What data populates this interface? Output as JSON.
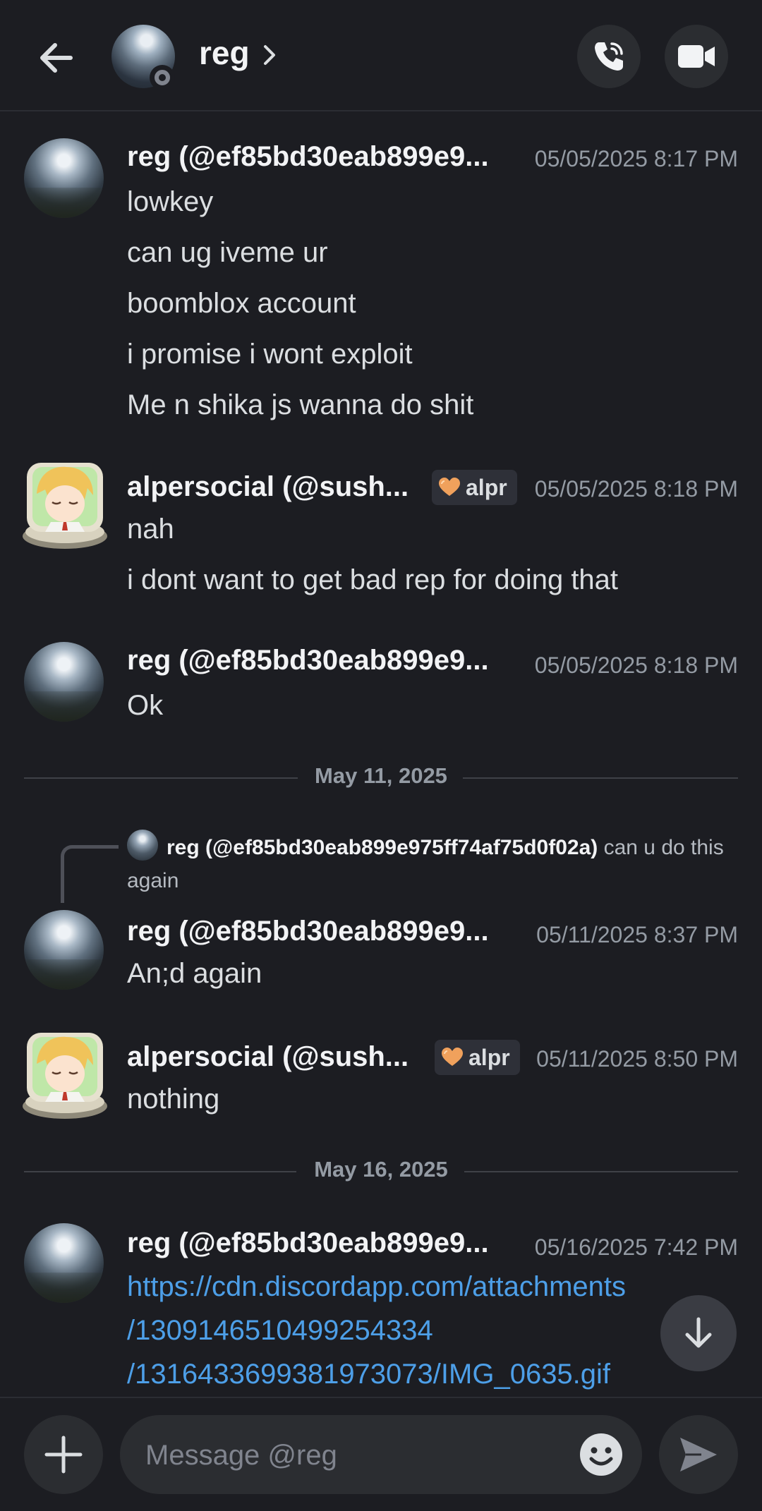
{
  "header": {
    "name": "reg"
  },
  "messages": [
    {
      "author": "reg (@ef85bd30eab899e9...",
      "time": "05/05/2025 8:17 PM",
      "lines": [
        "lowkey",
        "can ug iveme ur",
        "boomblox account",
        "i promise i wont exploit",
        "Me n shika js wanna do shit"
      ]
    },
    {
      "author": "alpersocial (@sush...",
      "tag": "alpr",
      "time": "05/05/2025 8:18 PM",
      "lines": [
        "nah",
        "i dont want to get bad rep for doing that"
      ]
    },
    {
      "author": "reg (@ef85bd30eab899e9...",
      "time": "05/05/2025 8:18 PM",
      "lines": [
        "Ok"
      ]
    },
    {
      "reply_author": "reg (@ef85bd30eab899e975ff74af75d0f02a)",
      "reply_text": "can u do this again",
      "author": "reg (@ef85bd30eab899e9...",
      "time": "05/11/2025 8:37 PM",
      "lines": [
        "An;d again"
      ]
    },
    {
      "author": "alpersocial (@sush...",
      "tag": "alpr",
      "time": "05/11/2025 8:50 PM",
      "lines": [
        "nothing"
      ]
    },
    {
      "author": "reg (@ef85bd30eab899e9...",
      "time": "05/16/2025 7:42 PM",
      "lines": [
        "https://cdn.discordapp.com/attachments",
        "/1309146510499254334",
        "/1316433699381973073/IMG_0635.gif"
      ]
    }
  ],
  "dividers": [
    "May 11, 2025",
    "May 16, 2025"
  ],
  "composer": {
    "placeholder": "Message @reg"
  },
  "icons": {
    "back": "arrow-left-icon",
    "call": "phone-icon",
    "video": "video-camera-icon",
    "scroll": "arrow-down-icon",
    "add": "plus-icon",
    "emoji": "smiley-icon",
    "send": "send-icon"
  },
  "colors": {
    "background": "#1c1d22",
    "link": "#4d9fe8",
    "muted": "#949ba4"
  }
}
